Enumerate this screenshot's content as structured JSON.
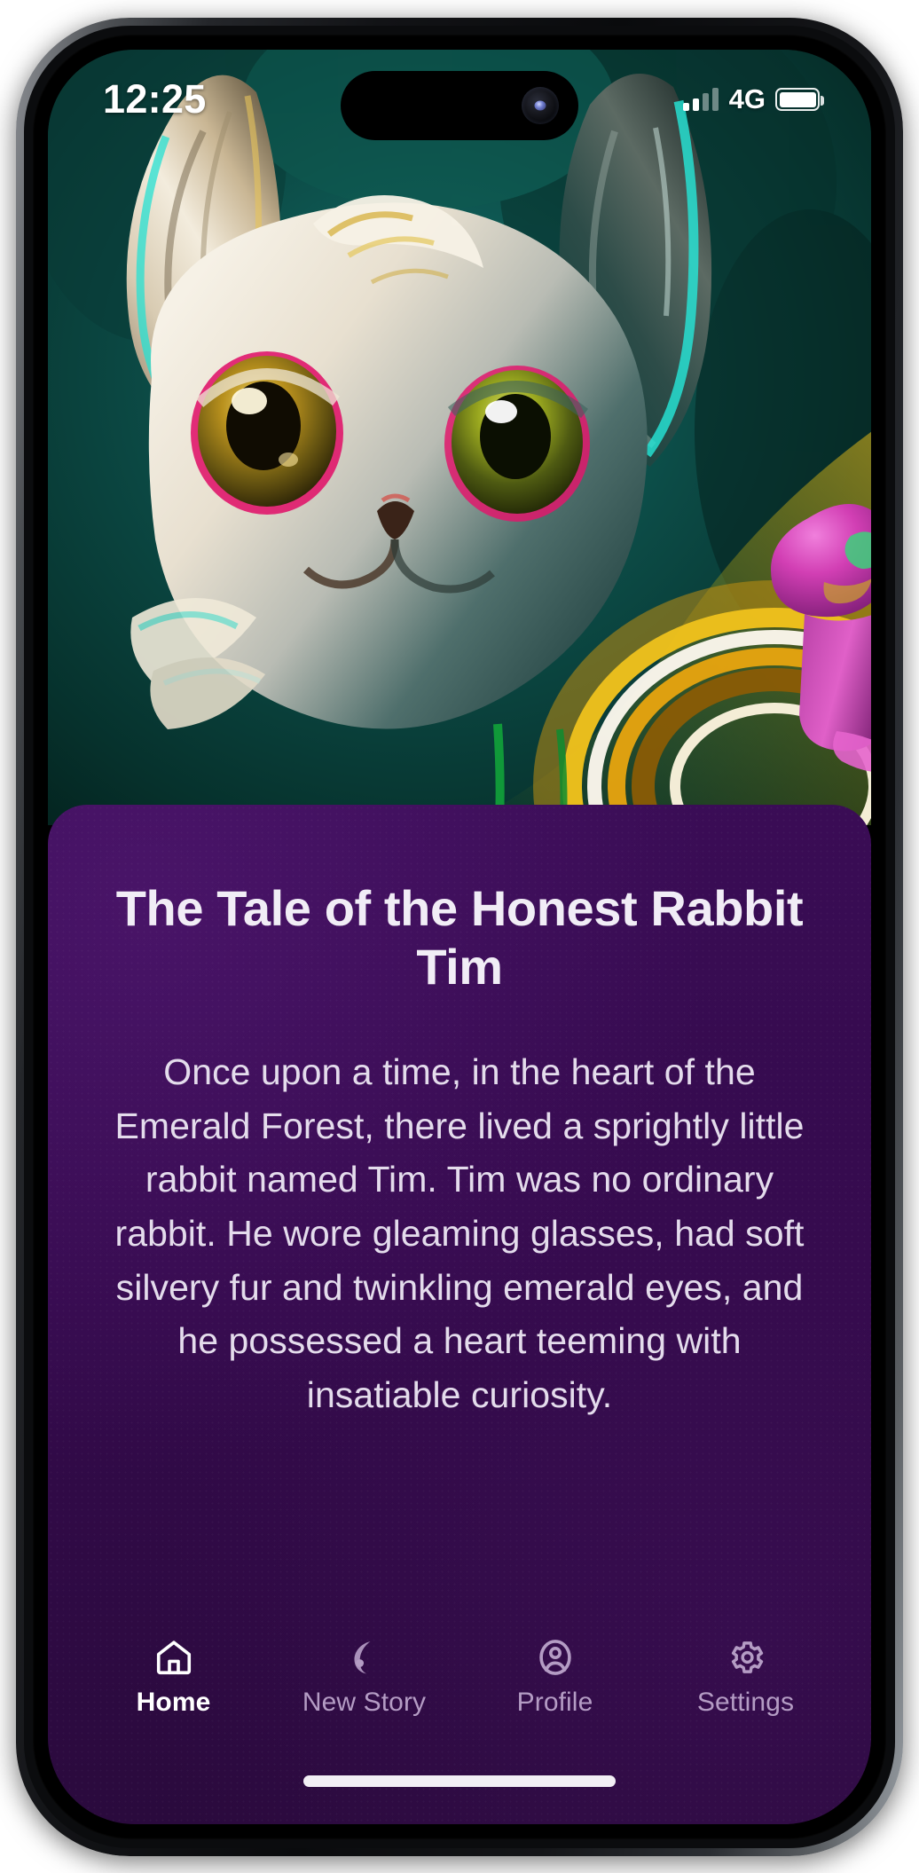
{
  "device": {
    "frame": "iphone-pro",
    "status_bar": {
      "time": "12:25",
      "network_label": "4G",
      "signal_bars_total": 4,
      "signal_bars_filled": 2,
      "battery_level_percent": 100
    }
  },
  "hero": {
    "alt": "Illustrated close-up portrait of a silvery-white fantasy rabbit with large golden-green eyes and teal-tipped ears in an emerald forest, with a pink mushroom and glowing golden rings to the right",
    "palette": {
      "forest_dark": "#07231f",
      "forest_teal": "#0f5f58",
      "cyan_accent": "#23e8d8",
      "fur_cream": "#f2ece0",
      "fur_gold": "#d9a63c",
      "eye_gold": "#b8971f",
      "eye_rim_pink": "#e0176c",
      "mushroom_pink": "#d94bbb",
      "glow_yellow": "#f7c318",
      "glow_amber": "#a06b10",
      "stem_green": "#12a33a"
    }
  },
  "story": {
    "title": "The Tale of the Honest Rabbit Tim",
    "body": "Once upon a time, in the heart of the Emerald Forest, there lived a sprightly little rabbit named Tim. Tim was no ordinary rabbit. He wore gleaming glasses, had soft silvery fur and twinkling emerald eyes, and he possessed a heart teeming with insatiable curiosity.",
    "card_color": "#34084c",
    "title_color": "#f1edf6",
    "body_color": "#e4dcec"
  },
  "tabbar": {
    "active_index": 0,
    "active_color": "#ffffff",
    "inactive_color": "#b49cc4",
    "items": [
      {
        "label": "Home",
        "icon": "home-icon",
        "active": true
      },
      {
        "label": "New Story",
        "icon": "moon-icon",
        "active": false
      },
      {
        "label": "Profile",
        "icon": "person-icon",
        "active": false
      },
      {
        "label": "Settings",
        "icon": "gear-icon",
        "active": false
      }
    ]
  }
}
